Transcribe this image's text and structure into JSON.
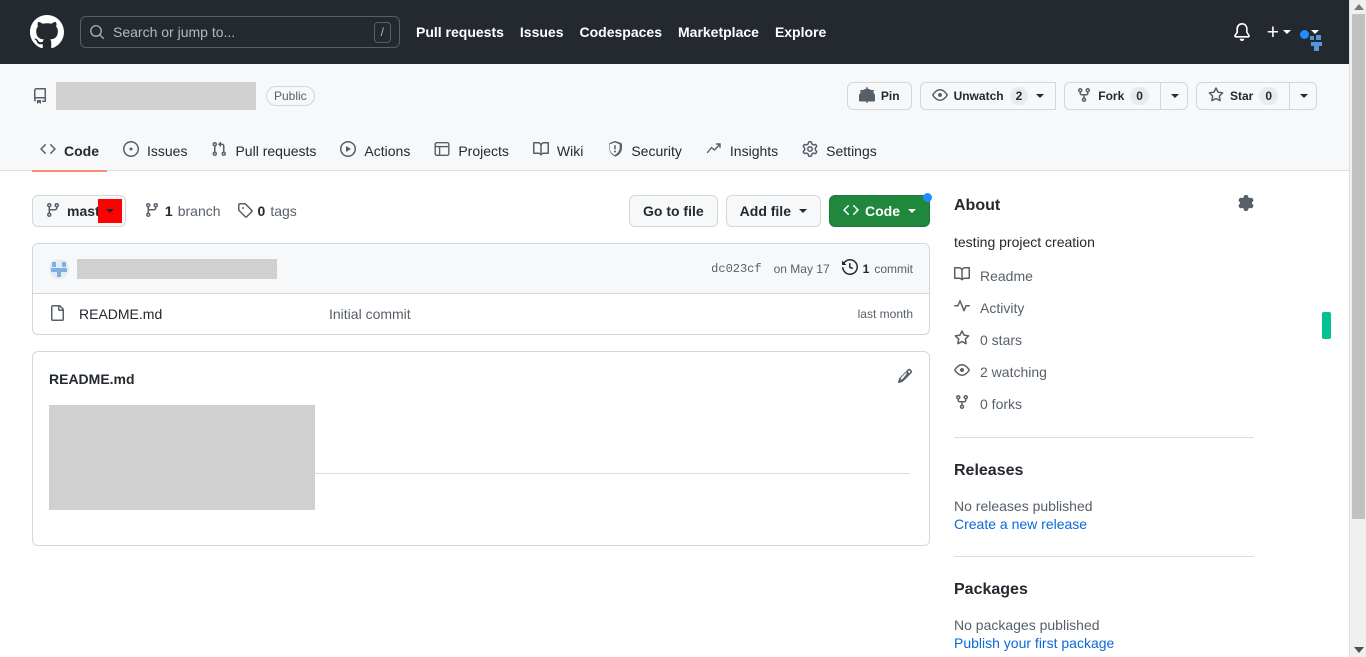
{
  "header": {
    "logo": "github-logo",
    "search": {
      "placeholder": "Search or jump to...",
      "shortcut": "/"
    },
    "nav": [
      {
        "label": "Pull requests"
      },
      {
        "label": "Issues"
      },
      {
        "label": "Codespaces"
      },
      {
        "label": "Marketplace"
      },
      {
        "label": "Explore"
      }
    ],
    "notifications_icon": "bell-icon",
    "create_new_icon": "plus-icon",
    "account_icon": "avatar"
  },
  "repo": {
    "name": "",
    "visibility": "Public",
    "actions": {
      "pin": "Pin",
      "unwatch": "Unwatch",
      "unwatch_count": "2",
      "fork": "Fork",
      "fork_count": "0",
      "star": "Star",
      "star_count": "0"
    },
    "tabs": [
      {
        "label": "Code",
        "icon": "code-icon",
        "selected": true
      },
      {
        "label": "Issues",
        "icon": "issue-opened-icon",
        "selected": false
      },
      {
        "label": "Pull requests",
        "icon": "git-pull-request-icon",
        "selected": false
      },
      {
        "label": "Actions",
        "icon": "play-icon",
        "selected": false
      },
      {
        "label": "Projects",
        "icon": "table-icon",
        "selected": false
      },
      {
        "label": "Wiki",
        "icon": "book-icon",
        "selected": false
      },
      {
        "label": "Security",
        "icon": "shield-icon",
        "selected": false
      },
      {
        "label": "Insights",
        "icon": "graph-icon",
        "selected": false
      },
      {
        "label": "Settings",
        "icon": "gear-icon",
        "selected": false
      }
    ]
  },
  "toolbar": {
    "branch": "master",
    "branches_count": "1",
    "branches_label": "branch",
    "tags_count": "0",
    "tags_label": "tags",
    "go_to_file": "Go to file",
    "add_file": "Add file",
    "code": "Code"
  },
  "commit": {
    "author": "",
    "message": "",
    "sha": "dc023cf",
    "date": "on May 17",
    "commits_count": "1",
    "commits_label": "commit"
  },
  "files": {
    "columns": [
      "name",
      "message",
      "date"
    ],
    "rows": [
      {
        "name": "README.md",
        "message": "Initial commit",
        "date": "last month",
        "icon": "file-icon"
      }
    ]
  },
  "readme": {
    "title": "README.md",
    "edit_icon": "pencil-icon",
    "content": ""
  },
  "about": {
    "heading": "About",
    "settings_icon": "gear-icon",
    "description": "testing project creation",
    "links": [
      {
        "label": "Readme",
        "icon": "book-icon"
      },
      {
        "label": "Activity",
        "icon": "pulse-icon"
      },
      {
        "label": "0 stars",
        "icon": "star-icon"
      },
      {
        "label": "2 watching",
        "icon": "eye-icon"
      },
      {
        "label": "0 forks",
        "icon": "repo-forked-icon"
      }
    ]
  },
  "releases": {
    "heading": "Releases",
    "empty": "No releases published",
    "action": "Create a new release"
  },
  "packages": {
    "heading": "Packages",
    "empty": "No packages published",
    "action": "Publish your first package"
  },
  "colors": {
    "header_bg": "#24292f",
    "accent_green": "#1f883d",
    "link_blue": "#0969da",
    "tab_underline": "#fd8c73",
    "highlight_red": "#ff0000",
    "marker_green": "#00c292"
  }
}
